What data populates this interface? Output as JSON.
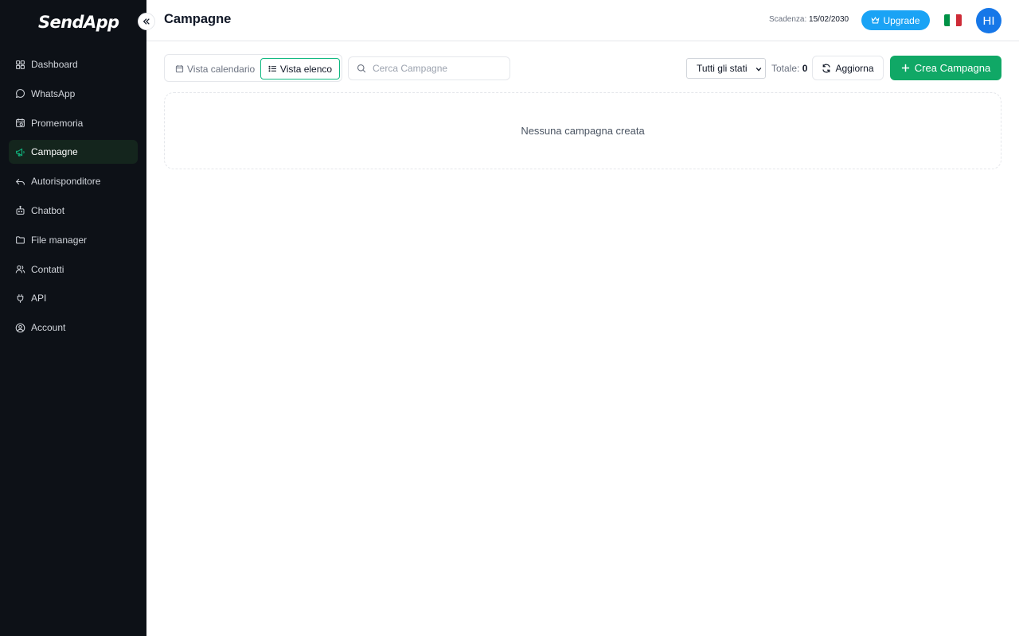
{
  "app": {
    "logo_text": "SendApp"
  },
  "sidebar": {
    "items": [
      {
        "label": "Dashboard",
        "icon": "dashboard-icon",
        "active": false
      },
      {
        "label": "WhatsApp",
        "icon": "chat-bubble-icon",
        "active": false
      },
      {
        "label": "Promemoria",
        "icon": "calendar-clock-icon",
        "active": false
      },
      {
        "label": "Campagne",
        "icon": "megaphone-icon",
        "active": true
      },
      {
        "label": "Autorisponditore",
        "icon": "reply-icon",
        "active": false
      },
      {
        "label": "Chatbot",
        "icon": "robot-icon",
        "active": false
      },
      {
        "label": "File manager",
        "icon": "folder-icon",
        "active": false
      },
      {
        "label": "Contatti",
        "icon": "users-icon",
        "active": false
      },
      {
        "label": "API",
        "icon": "plug-icon",
        "active": false
      },
      {
        "label": "Account",
        "icon": "user-circle-icon",
        "active": false
      }
    ],
    "active_color": "#10b981"
  },
  "header": {
    "title": "Campagne",
    "expiry_label": "Scadenza:",
    "expiry_date": "15/02/2030",
    "upgrade_label": "Upgrade",
    "avatar_initials": "HI",
    "flag_colors": [
      "#009246",
      "#ffffff",
      "#ce2b37"
    ]
  },
  "toolbar": {
    "view_calendar_label": "Vista calendario",
    "view_list_label": "Vista elenco",
    "search_placeholder": "Cerca Campagne",
    "search_value": "",
    "status_filter_value": "Tutti gli stati",
    "total_label": "Totale:",
    "total_count": "0",
    "refresh_label": "Aggiorna",
    "create_label": "Crea Campagna"
  },
  "main": {
    "empty_message": "Nessuna campagna creata"
  },
  "colors": {
    "accent": "#10a866",
    "upgrade": "#1aa3f5",
    "avatar": "#1677e8",
    "sidebar_bg": "#0d1117"
  }
}
